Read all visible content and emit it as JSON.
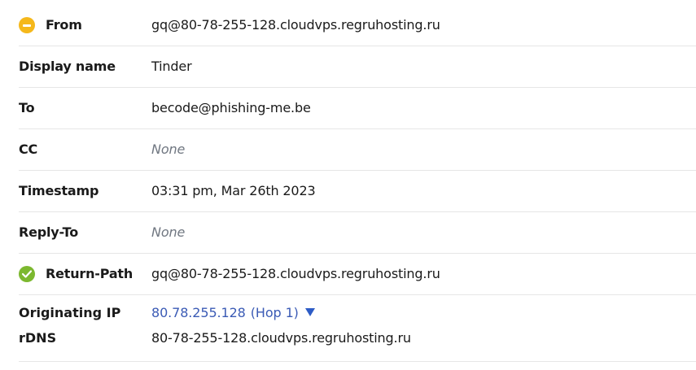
{
  "rows": [
    {
      "label": "From",
      "value": "gq@80-78-255-128.cloudvps.regruhosting.ru",
      "icon": "warning-minus-icon",
      "icon_color": "#f5b81b"
    },
    {
      "label": "Display name",
      "value": "Tinder"
    },
    {
      "label": "To",
      "value": "becode@phishing-me.be"
    },
    {
      "label": "CC",
      "value": "None"
    },
    {
      "label": "Timestamp",
      "value": "03:31 pm, Mar 26th 2023"
    },
    {
      "label": "Reply-To",
      "value": "None"
    },
    {
      "label": "Return-Path",
      "value": "gq@80-78-255-128.cloudvps.regruhosting.ru",
      "icon": "check-circle-icon",
      "icon_color": "#7cb82f"
    }
  ],
  "origin": {
    "ip_label": "Originating IP",
    "ip": "80.78.255.128",
    "hop": "(Hop 1)",
    "rdns_label": "rDNS",
    "rdns": "80-78-255-128.cloudvps.regruhosting.ru"
  },
  "colors": {
    "link": "#3b5bb5",
    "muted": "#707781",
    "divider": "#e6e6e6"
  }
}
